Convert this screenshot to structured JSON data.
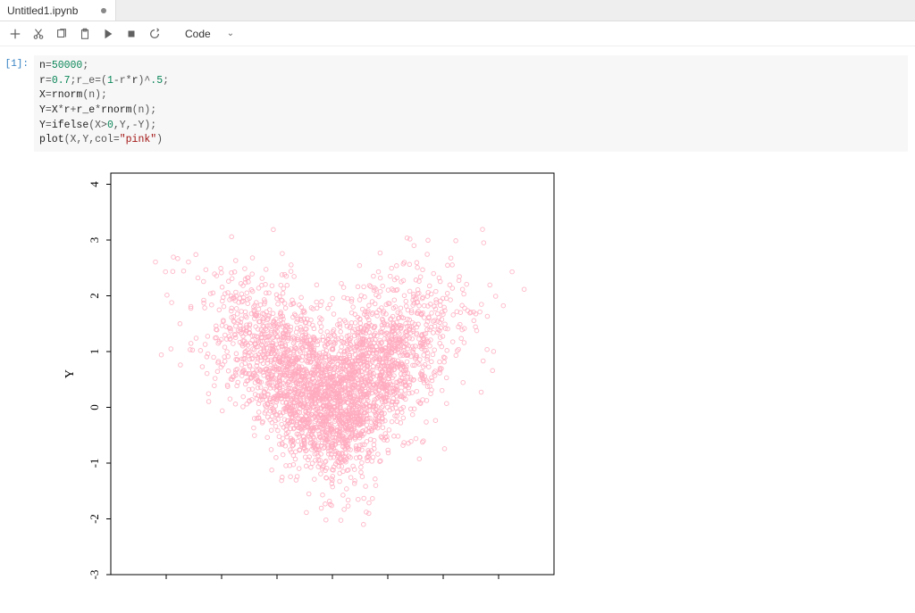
{
  "tab": {
    "title": "Untitled1.ipynb",
    "dirty": true
  },
  "toolbar": {
    "celltype_label": "Code"
  },
  "cell": {
    "prompt": "[1]:",
    "code_tokens": [
      [
        [
          "n",
          "var"
        ],
        [
          "=",
          "op"
        ],
        [
          "50000",
          "num"
        ],
        [
          ";",
          "op"
        ]
      ],
      [
        [
          "r",
          "var"
        ],
        [
          "=",
          "op"
        ],
        [
          "0.7",
          "num"
        ],
        [
          ";r_e",
          "op"
        ],
        [
          "=",
          "op"
        ],
        [
          "(",
          "op"
        ],
        [
          "1",
          "num"
        ],
        [
          "-r",
          "op"
        ],
        [
          "*",
          "op"
        ],
        [
          "r",
          "var"
        ],
        [
          ")",
          "op"
        ],
        [
          "^",
          "op"
        ],
        [
          ".5",
          "num"
        ],
        [
          ";",
          "op"
        ]
      ],
      [
        [
          "X",
          "var"
        ],
        [
          "=",
          "op"
        ],
        [
          "rnorm",
          "fn"
        ],
        [
          "(n);",
          "op"
        ]
      ],
      [
        [
          "Y",
          "var"
        ],
        [
          "=",
          "op"
        ],
        [
          "X",
          "var"
        ],
        [
          "*",
          "op"
        ],
        [
          "r",
          "var"
        ],
        [
          "+",
          "op"
        ],
        [
          "r_e",
          "var"
        ],
        [
          "*",
          "op"
        ],
        [
          "rnorm",
          "fn"
        ],
        [
          "(n);",
          "op"
        ]
      ],
      [
        [
          "Y",
          "var"
        ],
        [
          "=",
          "op"
        ],
        [
          "ifelse",
          "fn"
        ],
        [
          "(X",
          "op"
        ],
        [
          ">",
          "op"
        ],
        [
          "0",
          "num"
        ],
        [
          ",Y,",
          "op"
        ],
        [
          "-",
          "op"
        ],
        [
          "Y);",
          "op"
        ]
      ],
      [
        [
          "plot",
          "fn"
        ],
        [
          "(X,Y,col=",
          "op"
        ],
        [
          "\"pink\"",
          "str"
        ],
        [
          ")",
          "op"
        ]
      ]
    ]
  },
  "chart_data": {
    "type": "scatter",
    "n_points": 50000,
    "xlabel": "",
    "ylabel": "Y",
    "xlim": [
      -4,
      4
    ],
    "ylim": [
      -3,
      4.2
    ],
    "yticks": [
      -3,
      -2,
      -1,
      0,
      1,
      2,
      3,
      4
    ],
    "generator": "X~N(0,1); Y0=0.7*X+sqrt(0.51)*N(0,1); Y=sign(X)*Y0",
    "point_color": "pink",
    "description": "heart-shaped scatter cloud, dense pink open circles"
  }
}
